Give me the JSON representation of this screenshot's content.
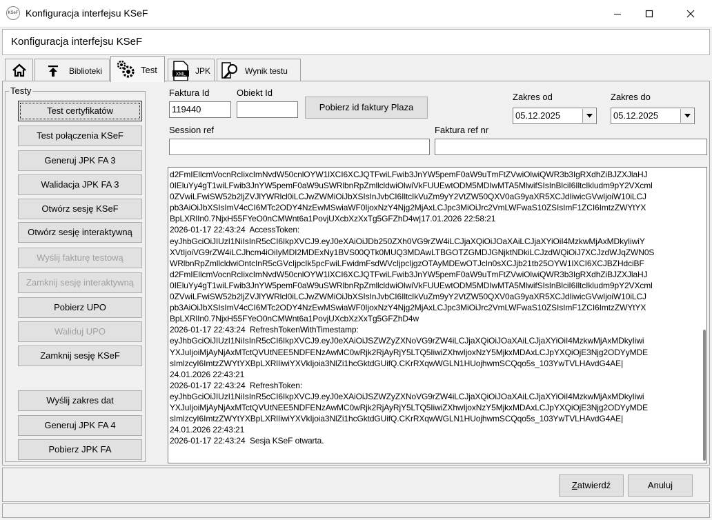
{
  "window": {
    "title": "Konfiguracja interfejsu KSeF",
    "icon_text": "KSeF"
  },
  "header": {
    "title": "Konfiguracja interfejsu KSeF"
  },
  "tabs": [
    {
      "label": "",
      "icon": "home-icon"
    },
    {
      "label": "Biblioteki",
      "icon": "arrow-up-bar-icon"
    },
    {
      "label": "Test",
      "icon": "gears-icon",
      "active": true
    },
    {
      "label": "JPK",
      "icon": "xml-document-icon"
    },
    {
      "label": "Wynik testu",
      "icon": "magnifier-document-icon"
    }
  ],
  "tests_group": {
    "title": "Testy",
    "buttons": [
      {
        "label": "Test certyfikatów",
        "enabled": true,
        "focused": true
      },
      {
        "label": "Test połączenia KSeF",
        "enabled": true
      },
      {
        "label": "Generuj JPK FA 3",
        "enabled": true
      },
      {
        "label": "Walidacja JPK FA 3",
        "enabled": true
      },
      {
        "label": "Otwórz sesję KSeF",
        "enabled": true
      },
      {
        "label": "Otwórz sesję interaktywną",
        "enabled": true
      },
      {
        "label": "Wyślij fakturę testową",
        "enabled": false
      },
      {
        "label": "Zamknij sesję interaktywną",
        "enabled": false
      },
      {
        "label": "Pobierz UPO",
        "enabled": true
      },
      {
        "label": "Waliduj UPO",
        "enabled": false
      },
      {
        "label": "Zamknij sesję KSeF",
        "enabled": true
      },
      {
        "label": "Wyślij zakres dat",
        "enabled": true
      },
      {
        "label": "Generuj JPK FA 4",
        "enabled": true
      },
      {
        "label": "Pobierz JPK FA",
        "enabled": true
      }
    ]
  },
  "form": {
    "faktura_id_label": "Faktura Id",
    "faktura_id_value": "119440",
    "obiekt_id_label": "Obiekt Id",
    "obiekt_id_value": "",
    "pobierz_button": "Pobierz id faktury Plaza",
    "zakres_od_label": "Zakres od",
    "zakres_od_value": "05.12.2025",
    "zakres_do_label": "Zakres do",
    "zakres_do_value": "05.12.2025",
    "session_ref_label": "Session ref",
    "session_ref_value": "",
    "faktura_ref_label": "Faktura ref nr",
    "faktura_ref_value": ""
  },
  "log": {
    "lines": [
      "d2FmIEllcmVocnRcIixcImNvdW50cnlOYW1lXCI6XCJQTFwiLFwib3JnYW5pemF0aW9uTmFtZVwiOlwiQWR3b3IgRXdhZiBJZXJlaHJ",
      "0IEluYy4gT1wiLFwib3JnYW5pemF0aW9uSWRlbnRpZmllcldwiOlwiVkFUUEwtODM5MDIwMTA5MlwifSIsInBlciI6IltcIkludm9pY2VXcml",
      "0ZVwiLFwiSW52b2ljZVJlYWRlcl0iLCJwZWMiOiJbXSIsInJvbCI6IltcIkVuZm9yY2VtZW50QXV0aG9yaXR5XCJdIiwicGVwIjoiW10iLCJ",
      "pb3AiOiJbXSIsImV4cCI6MTc2ODY4NzEwMSwiaWF0IjoxNzY4Njg2MjAxLCJpc3MiOiJrc2VmLWFwaS10ZSIsImF1ZCI6ImtzZWYtYX",
      "BpLXRlIn0.7NjxH55FYeO0nCMWnt6a1PovjUXcbXzXxTg5GFZhD4w|17.01.2026 22:58:21",
      "2026-01-17 22:43:24  AccessToken:",
      "eyJhbGciOiJIUzI1NiIsInR5cCI6IkpXVCJ9.eyJ0eXAiOiJDb250ZXh0VG9rZW4iLCJjaXQiOiJOaXAiLCJjaXYiOiI4MzkwMjAxMDkyIiwiY",
      "XVtIjoiVG9rZW4iLCJhcm4iOiIyMDI2MDExNy1BVS00QTk0MUQ3MDAwLTBGOTZGMDJGNjktNDkiLCJzdWQiOiJ7XCJzdWJqZWN0S",
      "WRlbnRpZmllcldwiOntcInR5cGVcIjpcIk5pcFwiLFwidmFsdWVcIjpcIjgzOTAyMDEwOTJcIn0sXCJjb21tb25OYW1lXCI6XCJBZHdciBF",
      "d2FmIEllcmVocnRcIixcImNvdW50cnlOYW1lXCI6XCJQTFwiLFwib3JnYW5pemF0aW9uTmFtZVwiOlwiQWR3b3IgRXdhZiBJZXJlaHJ",
      "0IEluYy4gT1wiLFwib3JnYW5pemF0aW9uSWRlbnRpZmllcldwiOlwiVkFUUEwtODM5MDIwMTA5MlwifSIsInBlciI6IltcIkludm9pY2VXcml",
      "0ZVwiLFwiSW52b2ljZVJlYWRlcl0iLCJwZWMiOiJbXSIsInJvbCI6IltcIkVuZm9yY2VtZW50QXV0aG9yaXR5XCJdIiwicGVwIjoiW10iLCJ",
      "pb3AiOiJbXSIsImV4cCI6MTc2ODY4NzEwMSwiaWF0IjoxNzY4Njg2MjAxLCJpc3MiOiJrc2VmLWFwaS10ZSIsImF1ZCI6ImtzZWYtYX",
      "BpLXRlIn0.7NjxH55FYeO0nCMWnt6a1PovjUXcbXzXxTg5GFZhD4w",
      "2026-01-17 22:43:24  RefreshTokenWithTimestamp:",
      "eyJhbGciOiJIUzI1NiIsInR5cCI6IkpXVCJ9.eyJ0eXAiOiJSZWZyZXNoVG9rZW4iLCJjaXQiOiJOaXAiLCJjaXYiOiI4MzkwMjAxMDkyIiwi",
      "YXJuIjoiMjAyNjAxMTctQVUtNEE5NDFENzAwMC0wRjk2RjAyRjY5LTQ5IiwiZXhwIjoxNzY5MjkxMDAxLCJpYXQiOjE3Njg2ODYyMDE",
      "sImlzcyI6ImtzZWYtYXBpLXRlIiwiYXVkIjoia3NlZi1hcGktdGUifQ.CKrRXqwWGLN1HUojhwmSCQqo5s_103YwTVLHAvdG4AE|",
      "24.01.2026 22:43:21",
      "2026-01-17 22:43:24  RefreshToken:",
      "eyJhbGciOiJIUzI1NiIsInR5cCI6IkpXVCJ9.eyJ0eXAiOiJSZWZyZXNoVG9rZW4iLCJjaXQiOiJOaXAiLCJjaXYiOiI4MzkwMjAxMDkyIiwi",
      "YXJuIjoiMjAyNjAxMTctQVUtNEE5NDFENzAwMC0wRjk2RjAyRjY5LTQ5IiwiZXhwIjoxNzY5MjkxMDAxLCJpYXQiOjE3Njg2ODYyMDE",
      "sImlzcyI6ImtzZWYtYXBpLXRlIiwiYXVkIjoia3NlZi1hcGktdGUifQ.CKrRXqwWGLN1HUojhwmSCQqo5s_103YwTVLHAvdG4AE|",
      "24.01.2026 22:43:21",
      "2026-01-17 22:43:24  Sesja KSeF otwarta."
    ]
  },
  "footer": {
    "confirm_button": "Zatwierdź",
    "confirm_accel": "Z",
    "confirm_rest": "atwierdź",
    "cancel_button": "Anuluj",
    "status_text": ""
  }
}
